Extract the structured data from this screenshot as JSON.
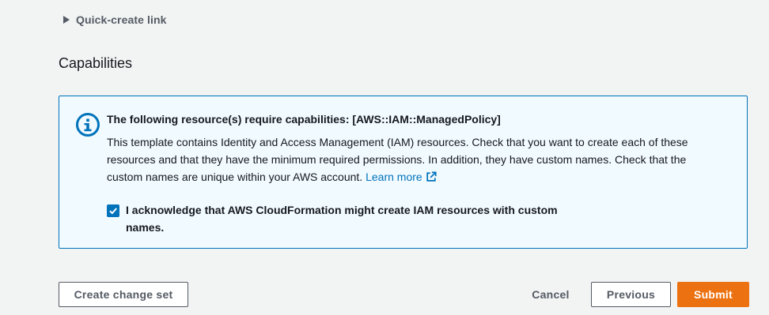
{
  "quick_create": {
    "label": "Quick-create link",
    "caret_icon": "caret-right-icon"
  },
  "capabilities": {
    "title": "Capabilities",
    "alert": {
      "icon": "info-icon",
      "heading": "The following resource(s) require capabilities: [AWS::IAM::ManagedPolicy]",
      "body": "This template contains Identity and Access Management (IAM) resources. Check that you want to create each of these resources and that they have the minimum required permissions. In addition, they have custom names. Check that the custom names are unique within your AWS account.",
      "learn_more": "Learn more",
      "learn_more_icon": "external-link-icon",
      "acknowledge_label": "I acknowledge that AWS CloudFormation might create IAM resources with custom names.",
      "acknowledge_checked": true
    }
  },
  "actions": {
    "create_change_set": "Create change set",
    "cancel": "Cancel",
    "previous": "Previous",
    "submit": "Submit"
  },
  "colors": {
    "accent": "#0073bb",
    "primary_button": "#ec7211",
    "alert_background": "#f1faff",
    "page_background": "#f2f3f3"
  }
}
